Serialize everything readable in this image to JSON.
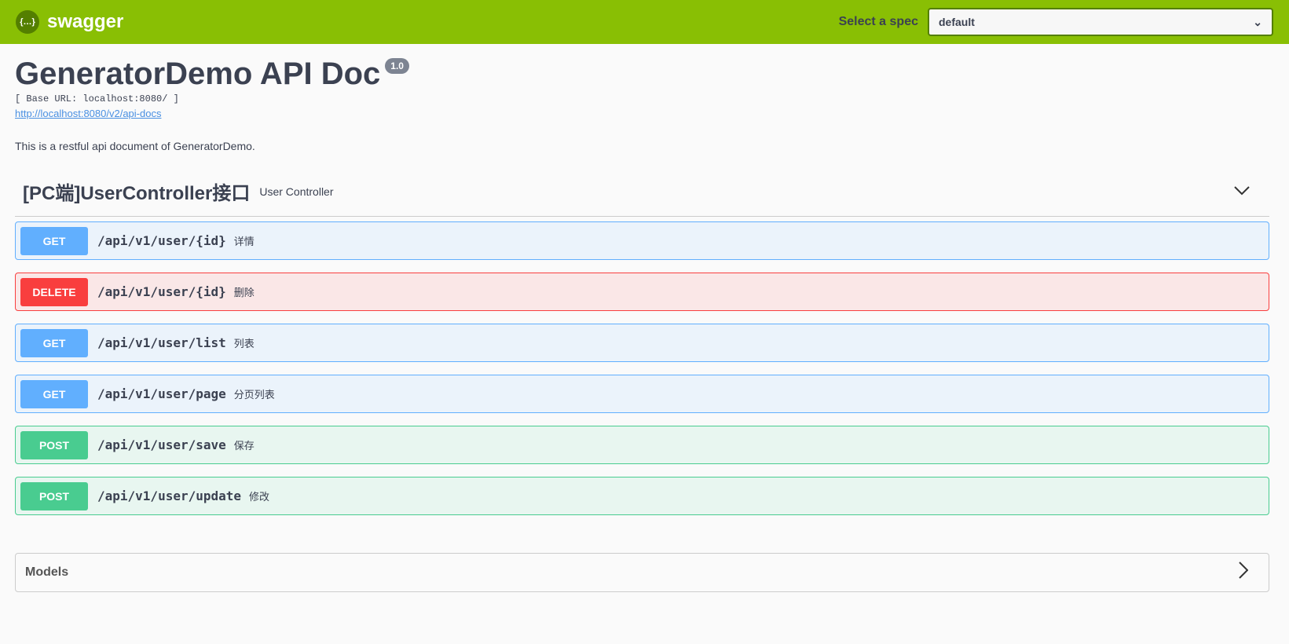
{
  "topbar": {
    "logo_glyph": "{…}",
    "logo_text": "swagger",
    "spec_label": "Select a spec",
    "spec_value": "default"
  },
  "info": {
    "title": "GeneratorDemo API Doc",
    "version": "1.0",
    "base_url": "[ Base URL: localhost:8080/ ]",
    "docs_link": "http://localhost:8080/v2/api-docs",
    "description": "This is a restful api document of GeneratorDemo."
  },
  "tag": {
    "name": "[PC端]UserController接口",
    "description": "User Controller"
  },
  "colors": {
    "GET": {
      "badge": "#61affe",
      "bg": "#ebf3fb",
      "border": "#61affe"
    },
    "DELETE": {
      "badge": "#f93e3e",
      "bg": "#fae7e7",
      "border": "#f93e3e"
    },
    "POST": {
      "badge": "#49cc90",
      "bg": "#e8f6f0",
      "border": "#49cc90"
    }
  },
  "operations": [
    {
      "method": "GET",
      "path": "/api/v1/user/{id}",
      "summary": "详情"
    },
    {
      "method": "DELETE",
      "path": "/api/v1/user/{id}",
      "summary": "删除"
    },
    {
      "method": "GET",
      "path": "/api/v1/user/list",
      "summary": "列表"
    },
    {
      "method": "GET",
      "path": "/api/v1/user/page",
      "summary": "分页列表"
    },
    {
      "method": "POST",
      "path": "/api/v1/user/save",
      "summary": "保存"
    },
    {
      "method": "POST",
      "path": "/api/v1/user/update",
      "summary": "修改"
    }
  ],
  "models": {
    "label": "Models"
  }
}
